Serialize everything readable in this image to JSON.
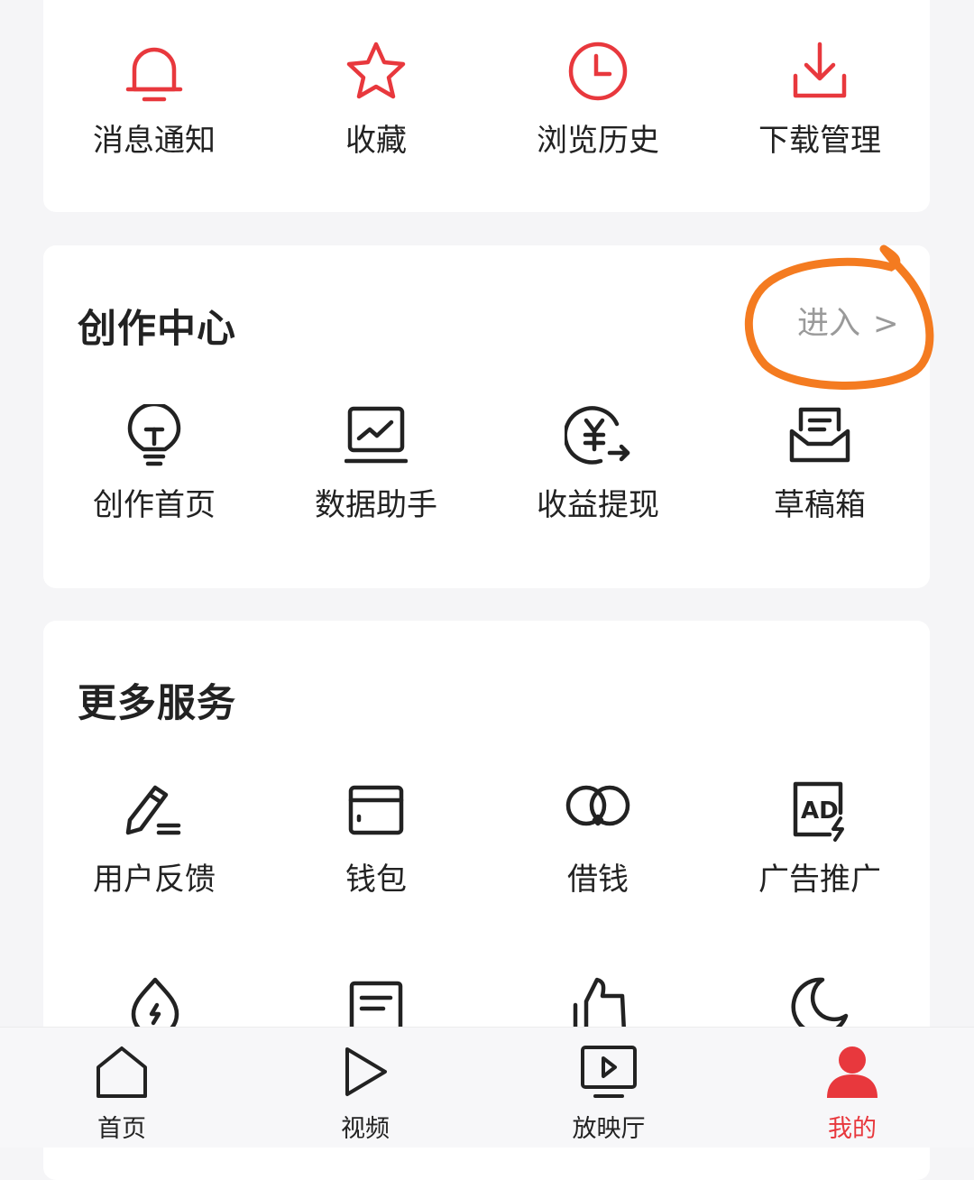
{
  "quick_actions": [
    {
      "label": "消息通知",
      "icon": "bell-icon"
    },
    {
      "label": "收藏",
      "icon": "star-icon"
    },
    {
      "label": "浏览历史",
      "icon": "clock-icon"
    },
    {
      "label": "下载管理",
      "icon": "download-icon"
    }
  ],
  "creation_center": {
    "title": "创作中心",
    "enter_label": "进入",
    "items": [
      {
        "label": "创作首页",
        "icon": "lightbulb-icon"
      },
      {
        "label": "数据助手",
        "icon": "chart-laptop-icon"
      },
      {
        "label": "收益提现",
        "icon": "yuan-withdraw-icon"
      },
      {
        "label": "草稿箱",
        "icon": "draft-box-icon"
      }
    ]
  },
  "more_services": {
    "title": "更多服务",
    "items": [
      {
        "label": "用户反馈",
        "icon": "pencil-feedback-icon"
      },
      {
        "label": "钱包",
        "icon": "wallet-icon"
      },
      {
        "label": "借钱",
        "icon": "loan-icon"
      },
      {
        "label": "广告推广",
        "icon": "ad-promo-icon"
      }
    ],
    "row2_icons": [
      "flame-icon",
      "notes-icon",
      "thumbs-up-icon",
      "moon-icon"
    ]
  },
  "tabbar": {
    "active": "我的",
    "tabs": [
      {
        "label": "首页",
        "icon": "home-icon"
      },
      {
        "label": "视频",
        "icon": "play-icon"
      },
      {
        "label": "放映厅",
        "icon": "tv-icon"
      },
      {
        "label": "我的",
        "icon": "user-icon"
      }
    ]
  },
  "colors": {
    "accent": "#e8383d",
    "annotation": "#f47b20",
    "muted": "#9a9a9a"
  }
}
